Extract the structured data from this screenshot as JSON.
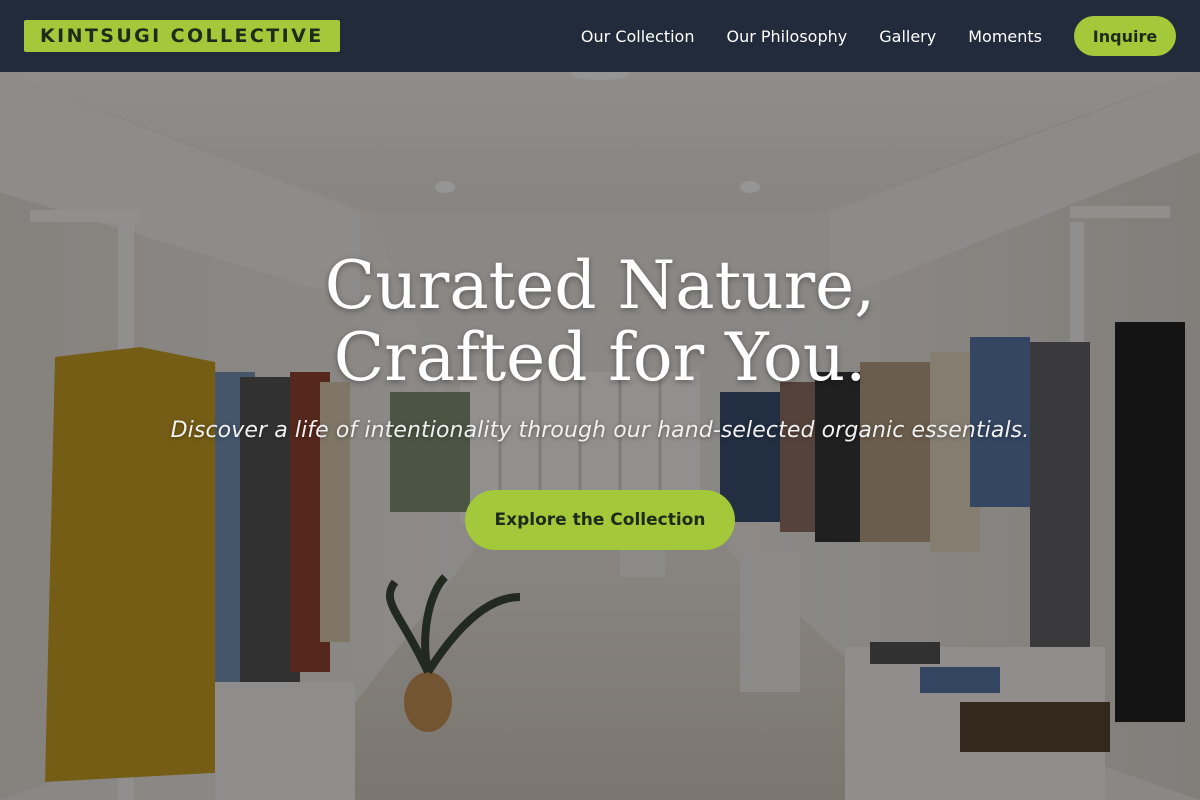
{
  "brand": {
    "logo_text": "KINTSUGI COLLECTIVE",
    "accent_color": "#a3c93a",
    "nav_background": "#212b3b"
  },
  "nav": {
    "links": [
      "Our Collection",
      "Our Philosophy",
      "Gallery",
      "Moments"
    ],
    "cta_label": "Inquire"
  },
  "hero": {
    "title_line1": "Curated Nature,",
    "title_line2": "Crafted for You.",
    "subtitle": "Discover a life of intentionality through our hand-selected organic essentials.",
    "cta_label": "Explore the Collection",
    "background_image": "clothing-boutique-interior"
  }
}
